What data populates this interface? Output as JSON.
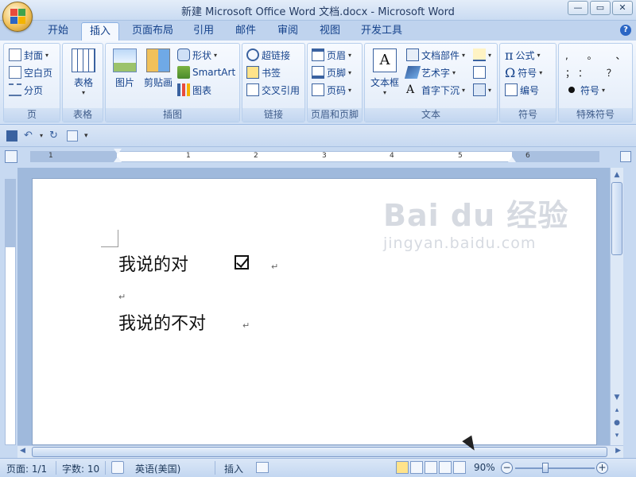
{
  "window": {
    "title": "新建 Microsoft Office Word 文档.docx - Microsoft Word",
    "minimize_glyph": "—",
    "restore_glyph": "▭",
    "close_glyph": "✕"
  },
  "tabs": [
    {
      "label": "开始"
    },
    {
      "label": "插入"
    },
    {
      "label": "页面布局"
    },
    {
      "label": "引用"
    },
    {
      "label": "邮件"
    },
    {
      "label": "审阅"
    },
    {
      "label": "视图"
    },
    {
      "label": "开发工具"
    }
  ],
  "active_tab": "插入",
  "help_glyph": "?",
  "ribbon": {
    "pages": {
      "label": "页",
      "cover": "封面",
      "blank": "空白页",
      "break": "分页"
    },
    "tables": {
      "label": "表格",
      "table": "表格"
    },
    "illustrations": {
      "label": "插图",
      "picture": "图片",
      "clipart": "剪贴画",
      "shapes": "形状",
      "smartart": "SmartArt",
      "chart": "图表"
    },
    "links": {
      "label": "链接",
      "hyperlink": "超链接",
      "bookmark": "书签",
      "crossref": "交叉引用"
    },
    "header_footer": {
      "label": "页眉和页脚",
      "header": "页眉",
      "footer": "页脚",
      "pagenum": "页码"
    },
    "text": {
      "label": "文本",
      "textbox": "文本框",
      "quickparts": "文档部件",
      "wordart": "艺术字",
      "dropcap": "首字下沉"
    },
    "symbols": {
      "label": "符号",
      "equation": "公式",
      "symbol": "符号",
      "numbering": "编号",
      "pi": "π",
      "omega": "Ω"
    },
    "special": {
      "label": "特殊符号",
      "row1": ", 。 、",
      "row2": "；： ？",
      "symbol": "符号"
    }
  },
  "ruler": {
    "h_numbers": [
      "1",
      "1",
      "2",
      "3",
      "4",
      "5",
      "6"
    ]
  },
  "document": {
    "line1": "我说的对",
    "line2": "我说的不对",
    "para_mark": "↵"
  },
  "watermark": {
    "line1": "Bai du 经验",
    "line2": "jingyan.baidu.com"
  },
  "statusbar": {
    "page": "页面: 1/1",
    "words": "字数: 10",
    "language": "英语(美国)",
    "mode": "插入",
    "zoom": "90%",
    "zoom_minus": "−",
    "zoom_plus": "+",
    "zoom_fraction": 0.38
  },
  "colors": {
    "accent": "#15428b",
    "ribbon_bg": "#dbe7f7"
  }
}
